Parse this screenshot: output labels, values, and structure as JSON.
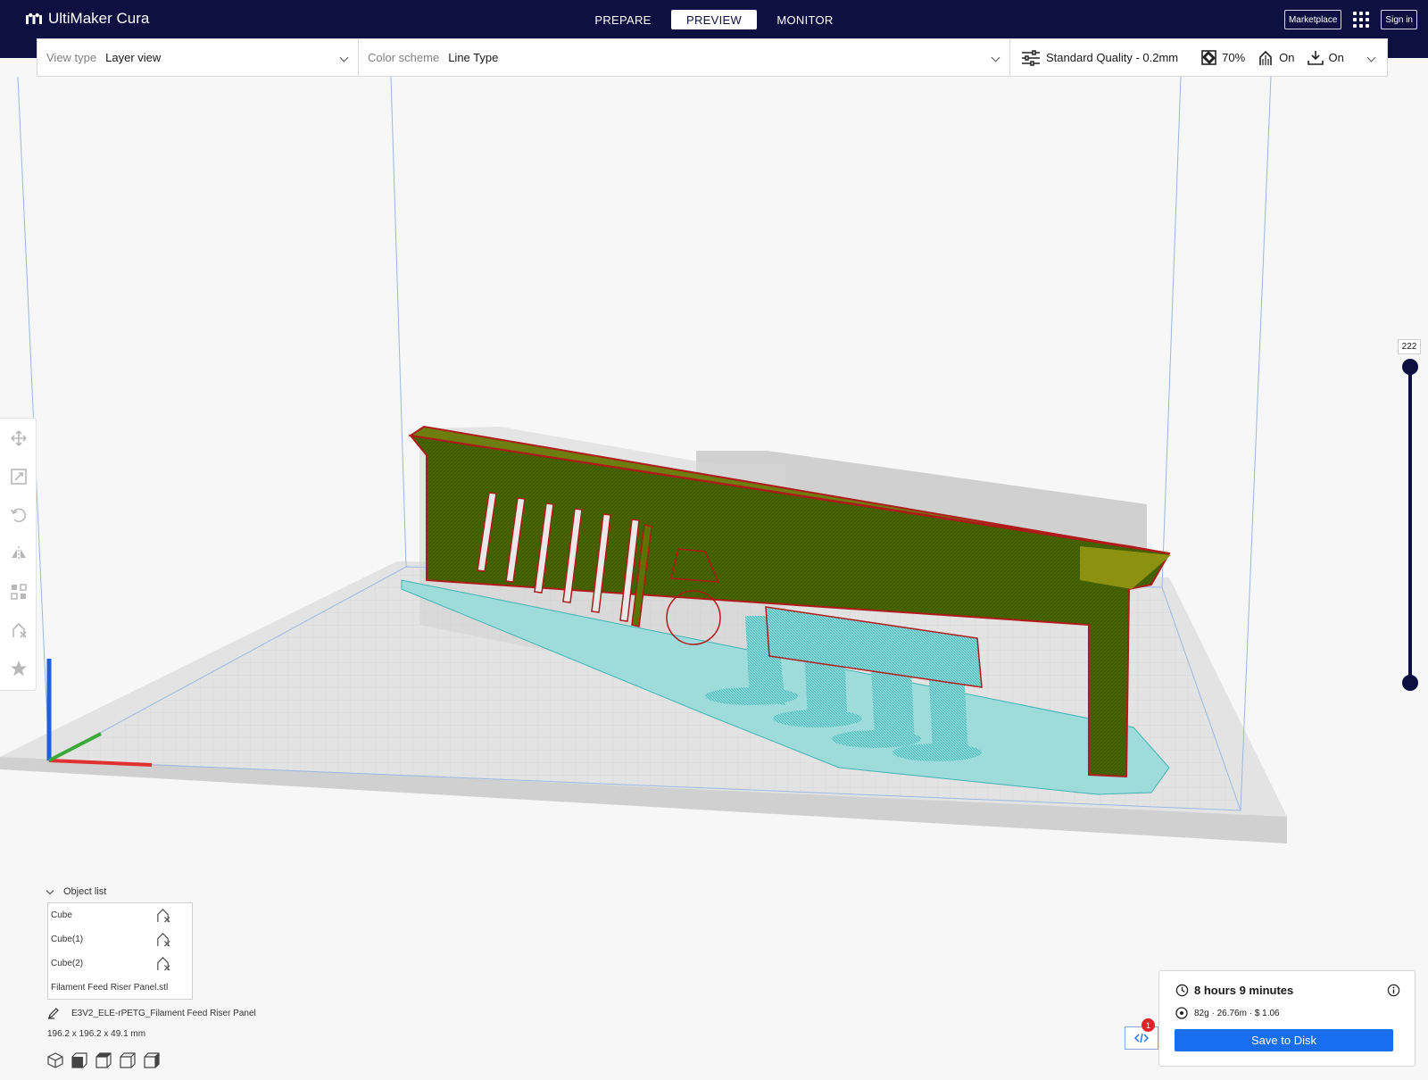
{
  "app": {
    "name": "UltiMaker Cura"
  },
  "stages": [
    {
      "label": "PREPARE",
      "active": false
    },
    {
      "label": "PREVIEW",
      "active": true
    },
    {
      "label": "MONITOR",
      "active": false
    }
  ],
  "header": {
    "marketplace_label": "Marketplace",
    "signin_label": "Sign in",
    "apps_icon": "grid-icon"
  },
  "view_settings": {
    "view_type_label": "View type",
    "view_type_value": "Layer view",
    "color_scheme_label": "Color scheme",
    "color_scheme_value": "Line Type"
  },
  "print_setup": {
    "profile": "Standard Quality - 0.2mm",
    "infill": "70%",
    "support": "On",
    "adhesion": "On"
  },
  "layer_slider": {
    "current_layer": "222",
    "min_fraction": 0,
    "max_fraction": 1
  },
  "tools": [
    {
      "name": "move-tool",
      "icon": "move-icon"
    },
    {
      "name": "scale-tool",
      "icon": "scale-icon"
    },
    {
      "name": "rotate-tool",
      "icon": "rotate-icon"
    },
    {
      "name": "mirror-tool",
      "icon": "mirror-icon"
    },
    {
      "name": "per-model-settings-tool",
      "icon": "per-model-icon"
    },
    {
      "name": "support-blocker-tool",
      "icon": "support-blocker-icon"
    },
    {
      "name": "custom-supports-tool",
      "icon": "star-icon"
    }
  ],
  "object_list": {
    "title": "Object list",
    "items": [
      "Cube",
      "Cube(1)",
      "Cube(2)",
      "Filament Feed Riser Panel.stl"
    ]
  },
  "project": {
    "name": "E3V2_ELE-rPETG_Filament Feed Riser Panel",
    "dimensions": "196.2 x 196.2 x 49.1 mm"
  },
  "output": {
    "print_time": "8 hours 9 minutes",
    "material_summary": "82g · 26.76m · $ 1.06",
    "save_label": "Save to Disk",
    "notification_count": "1"
  },
  "colors": {
    "header_bg": "#0e1041",
    "accent": "#196ef0",
    "wall": "#3c5a00",
    "outer_wall": "#c41818",
    "support": "#5ec8c8",
    "notification": "#e3232b"
  }
}
